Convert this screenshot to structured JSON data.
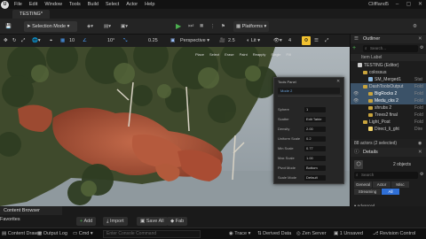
{
  "menubar": {
    "items": [
      "File",
      "Edit",
      "Window",
      "Tools",
      "Build",
      "Select",
      "Actor",
      "Help"
    ],
    "project": "Cliffland5"
  },
  "level_tab": {
    "label": "TESTING*"
  },
  "toolbar": {
    "mode": "Selection Mode",
    "platforms": "Platforms"
  },
  "viewport_toolbar": {
    "numbers": {
      "grid": "10",
      "rot": "10°",
      "scale": "0.25"
    },
    "perspective": "Perspective",
    "speed": "2.5",
    "lit": "Lit",
    "fov": "4"
  },
  "viewport_hud": [
    "Place",
    "Select",
    "Erase",
    "Paint",
    "Reapply",
    "Single",
    "Fill"
  ],
  "tools_panel": {
    "title": "Tools Panel",
    "sub": "Mode 2",
    "rows": [
      {
        "label": "Sphere",
        "value": "1"
      },
      {
        "label": "Scatter",
        "value": "Edit Table"
      },
      {
        "label": "Density",
        "value": "2.00"
      },
      {
        "label": "Uniform Scale",
        "value": "0.2"
      },
      {
        "label": "Min Scale",
        "value": "0.77"
      },
      {
        "label": "Max Scale",
        "value": "1.00"
      },
      {
        "label": "Pivot Mode",
        "value": "Bottom"
      },
      {
        "label": "Scale Mode",
        "value": "Default"
      }
    ]
  },
  "outliner": {
    "title": "Outliner",
    "search_placeholder": "Search...",
    "col_label": "Item Label",
    "rows": [
      {
        "label": "TESTING (Editor)",
        "type": "",
        "kind": "root"
      },
      {
        "label": "colossus",
        "type": "",
        "kind": "folder"
      },
      {
        "label": "SM_Merged1",
        "type": "Stat",
        "kind": "mesh"
      },
      {
        "label": "DashToolsOutput",
        "type": "Fold",
        "kind": "folder",
        "sel": true
      },
      {
        "label": "BigRocks 2",
        "type": "Fold",
        "kind": "folder",
        "sel": true
      },
      {
        "label": "Medu_cks 2",
        "type": "Fold",
        "kind": "folder",
        "sel": true
      },
      {
        "label": "shrubs 2",
        "type": "Fold",
        "kind": "folder"
      },
      {
        "label": "Trees2 final",
        "type": "Fold",
        "kind": "folder"
      },
      {
        "label": "Light_Post",
        "type": "Fold",
        "kind": "folder"
      },
      {
        "label": "Direct_li_ght",
        "type": "Dire",
        "kind": "mesh"
      }
    ],
    "footer": "88 actors (2 selected)"
  },
  "details": {
    "title": "Details",
    "objects": "2 objects",
    "search_placeholder": "Search",
    "tabs": [
      "General",
      "Actor",
      "Misc",
      "Streaming",
      "All"
    ],
    "section": "Advanced",
    "prop": "Relevant for Level Bou"
  },
  "content_browser": {
    "tab": "Content Browser",
    "favorites": "Favorites",
    "add": "Add",
    "import": "Import",
    "save_all": "Save All",
    "fab": "Fab"
  },
  "statusbar": {
    "drawer": "Content Drawer",
    "log": "Output Log",
    "cmd": "Cmd",
    "console_placeholder": "Enter Console Command",
    "trace": "Trace",
    "derived": "Derived Data",
    "zen": "Zen Server",
    "unsaved": "1 Unsaved",
    "revision": "Revision Control"
  }
}
